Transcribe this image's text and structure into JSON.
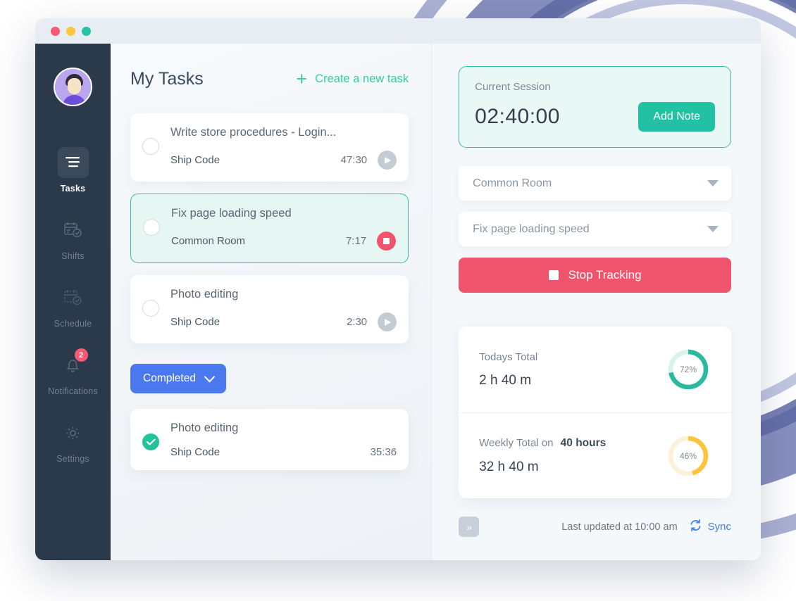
{
  "window": {
    "traffic_lights": [
      "close",
      "minimize",
      "maximize"
    ]
  },
  "sidebar": {
    "avatar_name": "user-avatar",
    "items": [
      {
        "label": "Tasks",
        "icon": "tasks-icon",
        "active": true,
        "badge": null
      },
      {
        "label": "Shifts",
        "icon": "shifts-icon",
        "active": false,
        "badge": null
      },
      {
        "label": "Schedule",
        "icon": "schedule-icon",
        "active": false,
        "badge": null
      },
      {
        "label": "Notifications",
        "icon": "bell-icon",
        "active": false,
        "badge": "2"
      },
      {
        "label": "Settings",
        "icon": "gear-icon",
        "active": false,
        "badge": null
      }
    ]
  },
  "main": {
    "page_title": "My Tasks",
    "create_task_label": "Create a new task",
    "plus_icon": "+",
    "completed_label": "Completed",
    "tasks": [
      {
        "title": "Write store procedures - Login...",
        "project": "Ship Code",
        "time": "47:30",
        "state": "idle",
        "control": "play"
      },
      {
        "title": "Fix page loading speed",
        "project": "Common Room",
        "time": "7:17",
        "state": "running",
        "control": "stop"
      },
      {
        "title": "Photo editing",
        "project": "Ship Code",
        "time": "2:30",
        "state": "idle",
        "control": "play"
      }
    ],
    "completed_tasks": [
      {
        "title": "Photo editing",
        "project": "Ship Code",
        "time": "35:36",
        "state": "done",
        "control": "none"
      }
    ]
  },
  "right": {
    "session": {
      "label": "Current Session",
      "time": "02:40:00",
      "add_note_label": "Add Note"
    },
    "room_select": {
      "value": "Common Room"
    },
    "task_select": {
      "value": "Fix page loading speed"
    },
    "stop_tracking_label": "Stop Tracking",
    "totals": [
      {
        "label": "Todays Total",
        "label_strong": "",
        "value": "2 h 40 m",
        "percent": 72,
        "color": "#2bb9a0",
        "track": "#daf2ec"
      },
      {
        "label": "Weekly Total on",
        "label_strong": "40 hours",
        "value": "32 h 40 m",
        "percent": 46,
        "color": "#fbc43a",
        "track": "#fcf1d8"
      }
    ],
    "footer": {
      "collapse_label": "»",
      "last_updated": "Last updated at 10:00 am",
      "sync_label": "Sync"
    }
  },
  "colors": {
    "accent_teal": "#2fbfa2",
    "accent_blue": "#4a79ef",
    "accent_red": "#f0536c",
    "accent_yellow": "#fbc43a",
    "sidebar_bg": "#2b3a4a"
  },
  "chart_data": [
    {
      "type": "pie",
      "title": "Todays Total",
      "categories": [
        "completed",
        "remaining"
      ],
      "values": [
        72,
        28
      ],
      "labels": [
        "72%"
      ],
      "color": "#2bb9a0"
    },
    {
      "type": "pie",
      "title": "Weekly Total on 40 hours",
      "categories": [
        "completed",
        "remaining"
      ],
      "values": [
        46,
        54
      ],
      "labels": [
        "46%"
      ],
      "color": "#fbc43a"
    }
  ]
}
